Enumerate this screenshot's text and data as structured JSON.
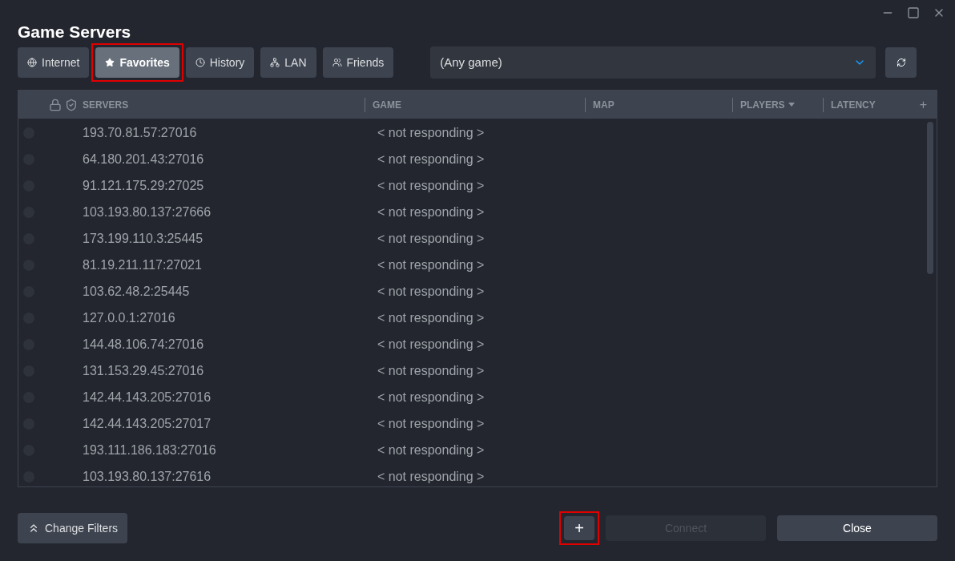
{
  "window": {
    "title": "Game Servers"
  },
  "tabs": [
    {
      "label": "Internet",
      "selected": false,
      "highlighted": false
    },
    {
      "label": "Favorites",
      "selected": true,
      "highlighted": true
    },
    {
      "label": "History",
      "selected": false,
      "highlighted": false
    },
    {
      "label": "LAN",
      "selected": false,
      "highlighted": false
    },
    {
      "label": "Friends",
      "selected": false,
      "highlighted": false
    }
  ],
  "game_filter": {
    "value": "(Any game)"
  },
  "table": {
    "columns": [
      {
        "label": "SERVERS",
        "sorted": false
      },
      {
        "label": "GAME",
        "sorted": false
      },
      {
        "label": "MAP",
        "sorted": false
      },
      {
        "label": "PLAYERS",
        "sorted": true
      },
      {
        "label": "LATENCY",
        "sorted": false
      }
    ],
    "add_column": "+",
    "rows": [
      {
        "server": "193.70.81.57:27016",
        "game": "< not responding >"
      },
      {
        "server": "64.180.201.43:27016",
        "game": "< not responding >"
      },
      {
        "server": "91.121.175.29:27025",
        "game": "< not responding >"
      },
      {
        "server": "103.193.80.137:27666",
        "game": "< not responding >"
      },
      {
        "server": "173.199.110.3:25445",
        "game": "< not responding >"
      },
      {
        "server": "81.19.211.117:27021",
        "game": "< not responding >"
      },
      {
        "server": "103.62.48.2:25445",
        "game": "< not responding >"
      },
      {
        "server": "127.0.0.1:27016",
        "game": "< not responding >"
      },
      {
        "server": "144.48.106.74:27016",
        "game": "< not responding >"
      },
      {
        "server": "131.153.29.45:27016",
        "game": "< not responding >"
      },
      {
        "server": "142.44.143.205:27016",
        "game": "< not responding >"
      },
      {
        "server": "142.44.143.205:27017",
        "game": "< not responding >"
      },
      {
        "server": "193.111.186.183:27016",
        "game": "< not responding >"
      },
      {
        "server": "103.193.80.137:27616",
        "game": "< not responding >"
      }
    ]
  },
  "footer": {
    "change_filters": "Change Filters",
    "add": {
      "label": "+",
      "highlighted": true
    },
    "connect": {
      "label": "Connect",
      "disabled": true
    },
    "close": "Close"
  }
}
